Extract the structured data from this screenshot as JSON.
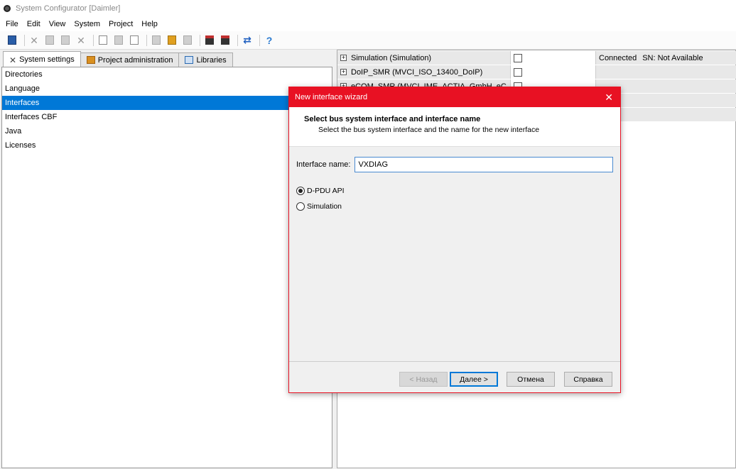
{
  "window": {
    "title": "System Configurator [Daimler]"
  },
  "menu": [
    "File",
    "Edit",
    "View",
    "System",
    "Project",
    "Help"
  ],
  "tabs": [
    {
      "label": "System settings",
      "icon": "tools-icon"
    },
    {
      "label": "Project administration",
      "icon": "project-icon"
    },
    {
      "label": "Libraries",
      "icon": "libraries-icon"
    }
  ],
  "settings_list": [
    "Directories",
    "Language",
    "Interfaces",
    "Interfaces CBF",
    "Java",
    "Licenses"
  ],
  "selected_setting": "Interfaces",
  "interfaces": [
    {
      "name": "Simulation (Simulation)",
      "status": "Connected",
      "sn": "SN: Not Available"
    },
    {
      "name": "DoIP_SMR (MVCI_ISO_13400_DoIP)",
      "status": "",
      "sn": ""
    },
    {
      "name": "eCOM_SMR (MVCI_IME_ACTIA_GmbH_eC",
      "status": "",
      "sn": ""
    }
  ],
  "dialog": {
    "title": "New interface wizard",
    "heading": "Select bus system interface and interface name",
    "subheading": "Select the bus system interface and the name for the new interface",
    "name_label": "Interface name:",
    "name_value": "VXDIAG",
    "options": [
      "D-PDU API",
      "Simulation"
    ],
    "selected_option": "D-PDU API",
    "buttons": {
      "back": "< Назад",
      "next": "Далее >",
      "cancel": "Отмена",
      "help": "Справка"
    }
  },
  "colors": {
    "accent": "#e81123",
    "selection": "#0078d7"
  }
}
